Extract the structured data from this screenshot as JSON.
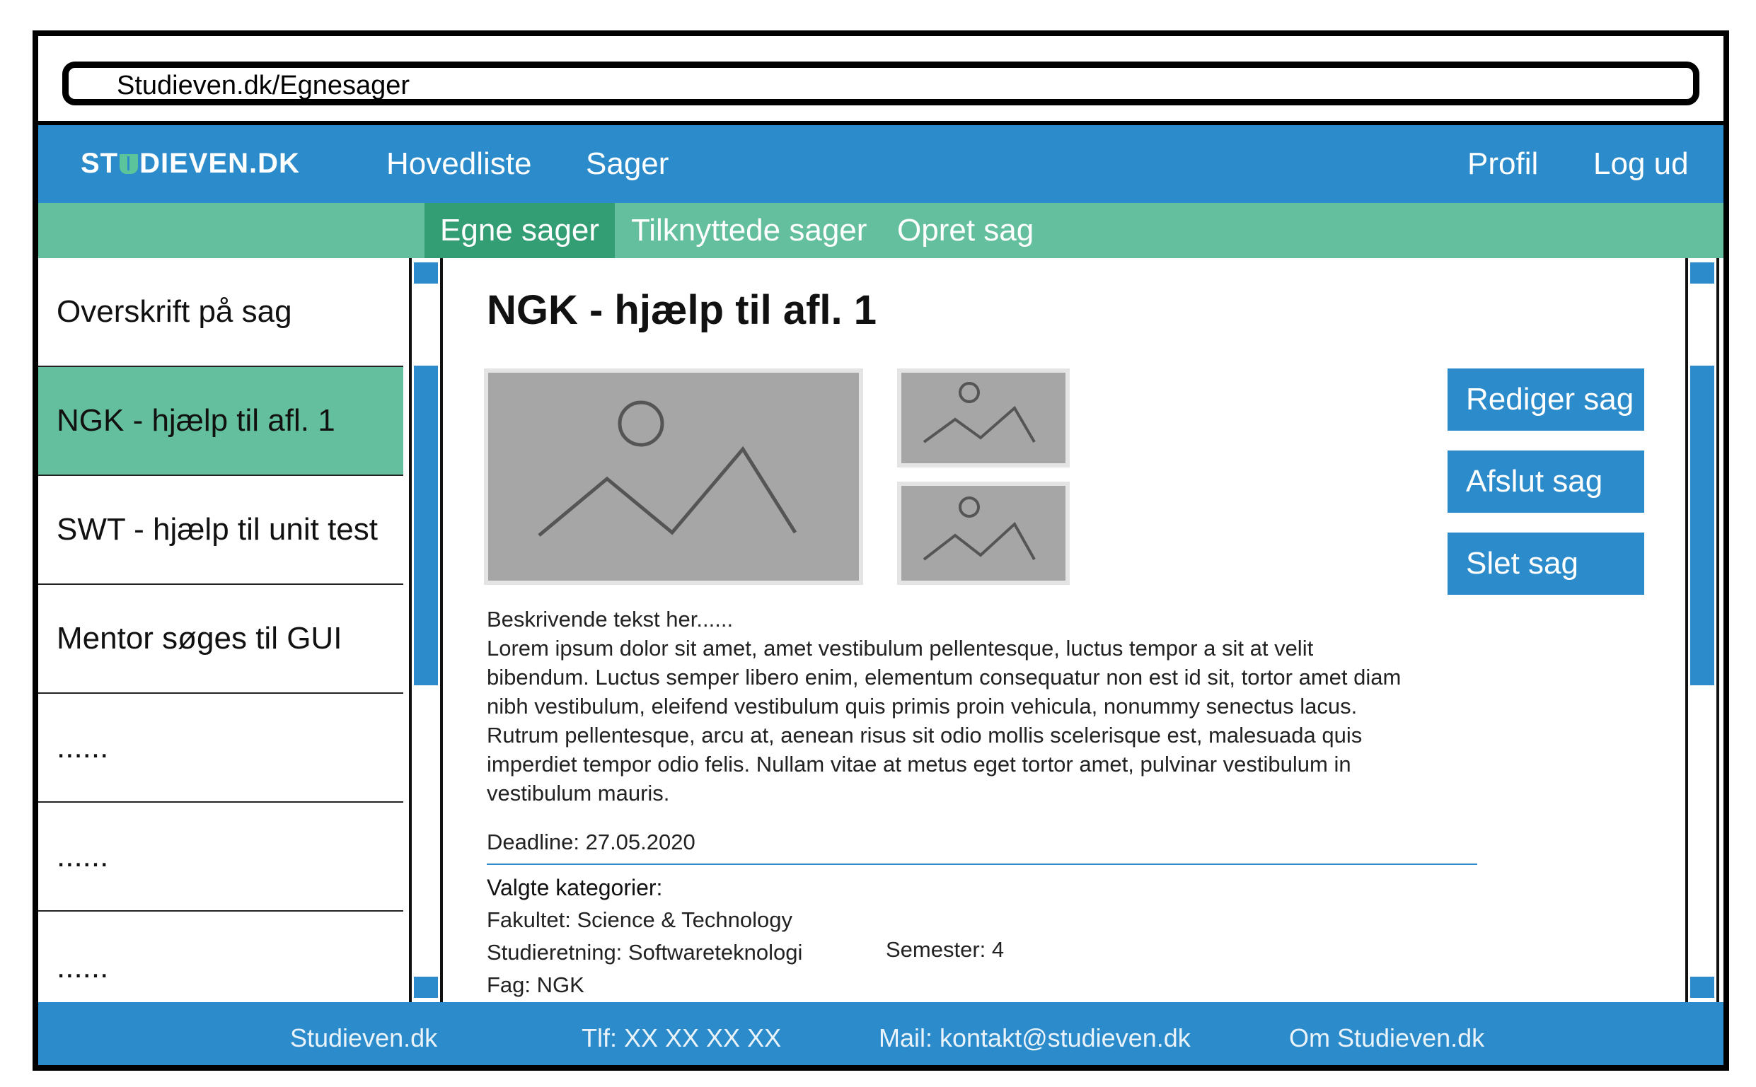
{
  "browser": {
    "url": "Studieven.dk/Egnesager"
  },
  "topnav": {
    "logo": "STUDIEVEN.DK",
    "logo_before": "ST",
    "logo_after": "DIEVEN.DK",
    "logo_icon": "book-icon",
    "links": [
      "Hovedliste",
      "Sager"
    ],
    "right_links": [
      "Profil",
      "Log ud"
    ]
  },
  "subnav": {
    "tabs": [
      "Egne sager",
      "Tilknyttede sager",
      "Opret sag"
    ],
    "active": "Egne sager"
  },
  "sidebar": {
    "items": [
      "Overskrift på sag",
      "NGK - hjælp til afl. 1",
      "SWT - hjælp til unit test",
      "Mentor søges til GUI",
      "......",
      "......",
      "......"
    ],
    "selected_index": 1
  },
  "main": {
    "title": "NGK - hjælp til afl. 1",
    "images": [
      "image-placeholder-icon",
      "image-placeholder-icon",
      "image-placeholder-icon"
    ],
    "buttons": {
      "edit": "Rediger sag",
      "close": "Afslut sag",
      "delete": "Slet sag"
    },
    "description_lines": [
      "Beskrivende tekst her......",
      "Lorem ipsum dolor sit amet, amet vestibulum pellentesque, luctus tempor a sit at velit",
      "bibendum. Luctus semper libero enim, elementum consequatur non est id sit, tortor amet diam",
      "nibh vestibulum, eleifend vestibulum quis primis proin vehicula, nonummy senectus lacus.",
      "Rutrum pellentesque, arcu at, aenean risus sit odio mollis scelerisque est, malesuada quis",
      "imperdiet tempor odio felis. Nullam vitae at metus eget tortor amet, pulvinar vestibulum in",
      "vestibulum mauris."
    ],
    "deadline": "Deadline: 27.05.2020",
    "categories": {
      "heading": "Valgte kategorier:",
      "faculty": "Fakultet: Science & Technology",
      "study": "Studieretning: Softwareteknologi",
      "subject": "Fag: NGK",
      "semester": "Semester: 4"
    }
  },
  "footer": {
    "links": [
      "Studieven.dk",
      "Tlf: XX XX XX XX",
      "Mail: kontakt@studieven.dk",
      "Om Studieven.dk"
    ]
  },
  "colors": {
    "primary_blue": "#2b8bcb",
    "green": "#64bf9e",
    "active_green": "#339e73",
    "placeholder_gray": "#a6a6a6"
  }
}
